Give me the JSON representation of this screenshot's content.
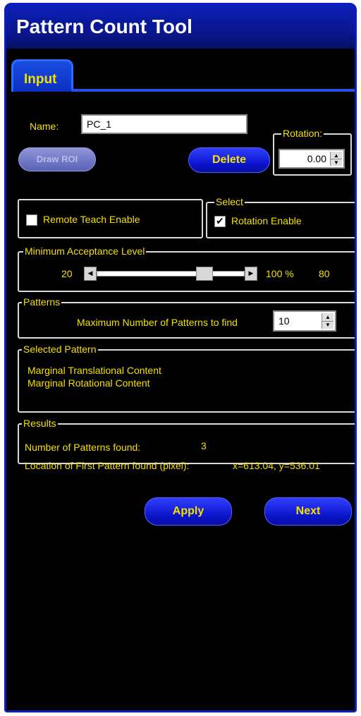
{
  "window": {
    "title": "Pattern Count Tool"
  },
  "tabs": [
    {
      "label": "Input",
      "active": true
    }
  ],
  "name_field": {
    "label": "Name:",
    "value": "PC_1"
  },
  "buttons": {
    "draw_roi": "Draw ROI",
    "delete": "Delete",
    "apply": "Apply",
    "next": "Next"
  },
  "rotation": {
    "legend": "Rotation:",
    "value": "0.00"
  },
  "remote_teach": {
    "label": "Remote Teach Enable",
    "checked": false
  },
  "select_group": {
    "legend": "Select",
    "rotation_enable": {
      "label": "Rotation Enable",
      "checked": true
    }
  },
  "acceptance": {
    "legend": "Minimum Acceptance Level",
    "min_label": "20",
    "max_label": "100 %",
    "current_label": "80",
    "fraction": 0.75
  },
  "patterns": {
    "legend": "Patterns",
    "max_label": "Maximum Number of Patterns to find",
    "max_value": "10"
  },
  "selected_pattern": {
    "legend": "Selected Pattern",
    "lines": [
      "Marginal Translational Content",
      "Marginal Rotational Content"
    ]
  },
  "results": {
    "legend": "Results",
    "count_label": "Number of Patterns found:",
    "count_value": "3",
    "location_label": "Location of First Pattern found (pixel):",
    "location_value": "x=613.04, y=536.01"
  },
  "colors": {
    "accent_text": "#f5e000",
    "button_blue": "#0a12c8",
    "frame_blue": "#0a1fbd"
  }
}
